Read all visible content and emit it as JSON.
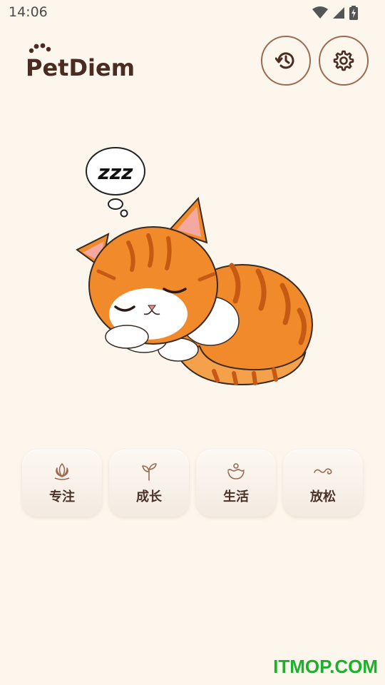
{
  "status_bar": {
    "time": "14:06",
    "icons": [
      "wifi-icon",
      "signal-icon",
      "battery-charging-icon"
    ]
  },
  "header": {
    "logo_text": "PetDiem",
    "history_icon": "history-icon",
    "settings_icon": "gear-icon"
  },
  "illustration": {
    "subject": "sleeping-orange-cat",
    "thought_bubble_text": "zzz"
  },
  "categories": [
    {
      "label": "专注",
      "icon": "lotus-icon"
    },
    {
      "label": "成长",
      "icon": "sprout-icon"
    },
    {
      "label": "生活",
      "icon": "bowl-icon"
    },
    {
      "label": "放松",
      "icon": "wave-icon"
    }
  ],
  "watermark": "ITMOP.COM",
  "colors": {
    "background": "#fdf6ec",
    "brand_brown": "#4a2c22",
    "button_border": "#9a6a52",
    "cat_orange": "#f08a2a",
    "watermark_green": "#1ab12c"
  }
}
